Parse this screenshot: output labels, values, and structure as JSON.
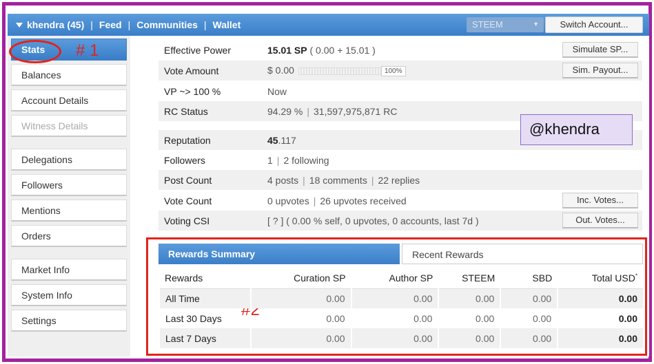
{
  "topbar": {
    "account": "khendra (45)",
    "nav": [
      "Feed",
      "Communities",
      "Wallet"
    ],
    "currency": "STEEM",
    "switch_account": "Switch Account..."
  },
  "sidebar": {
    "items": [
      {
        "label": "Stats",
        "active": true
      },
      {
        "label": "Balances"
      },
      {
        "label": "Account Details"
      },
      {
        "label": "Witness Details",
        "disabled": true
      },
      {
        "label": "Delegations"
      },
      {
        "label": "Followers"
      },
      {
        "label": "Mentions"
      },
      {
        "label": "Orders"
      },
      {
        "label": "Market Info"
      },
      {
        "label": "System Info"
      },
      {
        "label": "Settings"
      }
    ]
  },
  "stats": {
    "effective_power_label": "Effective Power",
    "effective_power_value": "15.01 SP",
    "effective_power_detail": "( 0.00 + 15.01 )",
    "simulate_sp": "Simulate SP...",
    "vote_amount_label": "Vote Amount",
    "vote_amount_value": "$ 0.00",
    "vote_slider_pct": "100%",
    "sim_payout": "Sim. Payout...",
    "vp_label": "VP ~> 100 %",
    "vp_value": "Now",
    "rc_label": "RC Status",
    "rc_pct": "94.29 %",
    "rc_value": "31,597,975,871 RC",
    "reputation_label": "Reputation",
    "reputation_int": "45",
    "reputation_dec": ".117",
    "followers_label": "Followers",
    "followers_value": "1",
    "following_value": "2 following",
    "post_count_label": "Post Count",
    "posts": "4 posts",
    "comments": "18 comments",
    "replies": "22 replies",
    "vote_count_label": "Vote Count",
    "upvotes": "0 upvotes",
    "upvotes_received": "26 upvotes received",
    "inc_votes": "Inc. Votes...",
    "csi_label": "Voting CSI",
    "csi_value": "[ ? ] ( 0.00 % self, 0 upvotes, 0 accounts, last 7d )",
    "out_votes": "Out. Votes..."
  },
  "username_callout": "@khendra",
  "annotations": {
    "one": "# 1",
    "two": "#2"
  },
  "rewards": {
    "tab_summary": "Rewards Summary",
    "tab_recent": "Recent Rewards",
    "headers": [
      "Rewards",
      "Curation SP",
      "Author SP",
      "STEEM",
      "SBD",
      "Total USD"
    ],
    "rows": [
      [
        "All Time",
        "0.00",
        "0.00",
        "0.00",
        "0.00",
        "0.00"
      ],
      [
        "Last 30 Days",
        "0.00",
        "0.00",
        "0.00",
        "0.00",
        "0.00"
      ],
      [
        "Last 7 Days",
        "0.00",
        "0.00",
        "0.00",
        "0.00",
        "0.00"
      ]
    ],
    "total_mark": "*"
  }
}
